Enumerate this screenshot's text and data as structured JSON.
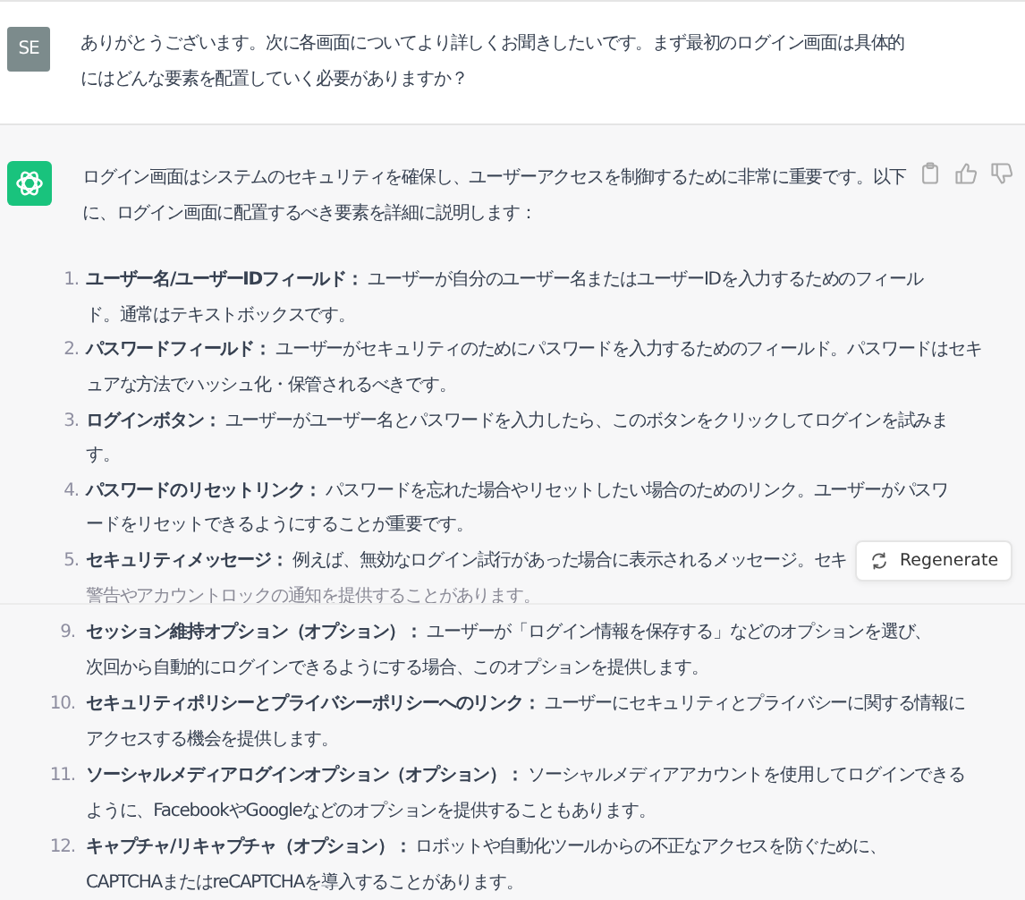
{
  "user_message": {
    "avatar": "SE",
    "lines": [
      "ありがとうございます。次に各画面についてより詳しくお聞きしたいです。まず最初のログイン画面は具体的",
      "にはどんな要素を配置していく必要がありますか？"
    ]
  },
  "assistant_message": {
    "intro_lines": [
      "ログイン画面はシステムのセキュリティを確保し、ユーザーアクセスを制御するために非常に重要です。以下",
      "に、ログイン画面に配置するべき要素を詳細に説明します："
    ],
    "items": [
      {
        "number": "1.",
        "lines": [
          "**ユーザー名/ユーザーIDフィールド：** ユーザーが自分のユーザー名またはユーザーIDを入力するためのフィール",
          "ド。通常はテキストボックスです。"
        ],
        "faded_line": false
      },
      {
        "number": "2.",
        "lines": [
          "**パスワードフィールド：** ユーザーがセキュリティのためにパスワードを入力するためのフィールド。パスワードはセキ",
          "ュアな方法でハッシュ化・保管されるべきです。"
        ],
        "faded_line": false
      },
      {
        "number": "3.",
        "lines": [
          "**ログインボタン：** ユーザーがユーザー名とパスワードを入力したら、このボタンをクリックしてログインを試みま",
          "す。"
        ],
        "faded_line": false
      },
      {
        "number": "4.",
        "lines": [
          "**パスワードのリセットリンク：** パスワードを忘れた場合やリセットしたい場合のためのリンク。ユーザーがパスワ",
          "ードをリセットできるようにすることが重要です。"
        ],
        "faded_line": false
      },
      {
        "number": "5.",
        "lines": [
          "**セキュリティメッセージ：** 例えば、無効なログイン試行があった場合に表示されるメッセージ。セキ",
          "警告やアカウントロックの通知を提供することがあります。"
        ],
        "faded_line": true
      }
    ],
    "regenerate_button": "Regenerate",
    "continued_items": [
      {
        "number": "9.",
        "lines": [
          "**セッション維持オプション（オプション）：** ユーザーが「ログイン情報を保存する」などのオプションを選び、",
          "次回から自動的にログインできるようにする場合、このオプションを提供します。"
        ]
      },
      {
        "number": "10.",
        "lines": [
          "**セキュリティポリシーとプライバシーポリシーへのリンク：** ユーザーにセキュリティとプライバシーに関する情報に",
          "アクセスする機会を提供します。"
        ]
      },
      {
        "number": "11.",
        "lines": [
          "**ソーシャルメディアログインオプション（オプション）：** ソーシャルメディアアカウントを使用してログインできる",
          "ように、FacebookやGoogleなどのオプションを提供することもあります。"
        ]
      },
      {
        "number": "12.",
        "lines": [
          "**キャプチャ/リキャプチャ（オプション）：** ロボットや自動化ツールからの不正なアクセスを防ぐために、",
          "CAPTCHAまたはreCAPTCHAを導入することがあります。"
        ]
      }
    ]
  }
}
